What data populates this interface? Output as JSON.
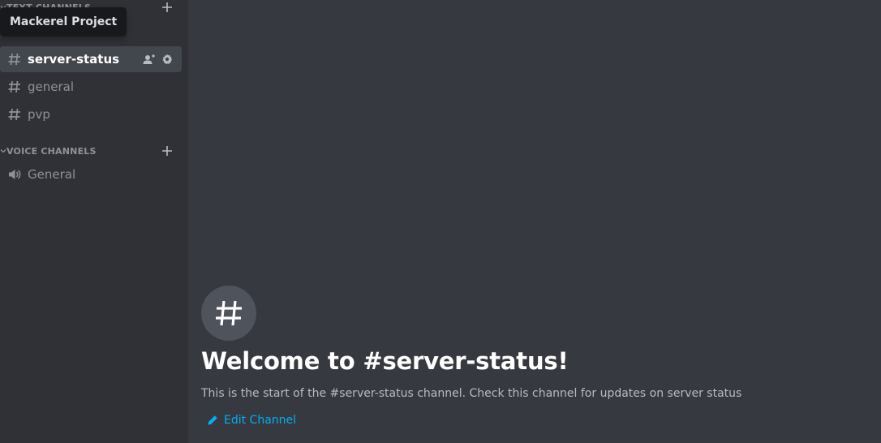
{
  "sidebar": {
    "tooltip": "Mackerel Project",
    "text_category": {
      "label": "TEXT CHANNELS",
      "icon": "chevron-down-icon",
      "add_icon": "plus-icon"
    },
    "text_channels": [
      {
        "name": "server-status",
        "icon": "hash-icon",
        "active": true
      },
      {
        "name": "general",
        "icon": "hash-icon",
        "active": false
      },
      {
        "name": "pvp",
        "icon": "hash-icon",
        "active": false
      }
    ],
    "active_channel_actions": [
      "invite-icon",
      "gear-icon"
    ],
    "voice_category": {
      "label": "VOICE CHANNELS",
      "icon": "chevron-down-icon",
      "add_icon": "plus-icon"
    },
    "voice_channels": [
      {
        "name": "General",
        "icon": "speaker-icon"
      }
    ]
  },
  "main": {
    "welcome_icon": "hash-icon",
    "welcome_title": "Welcome to #server-status!",
    "welcome_description": "This is the start of the #server-status channel. Check this channel for updates on server status",
    "edit_channel_label": "Edit Channel",
    "edit_icon": "pencil-icon"
  },
  "colors": {
    "sidebar_bg": "#2f3136",
    "main_bg": "#36393f",
    "active_channel_bg": "#42464d",
    "tooltip_bg": "#18191c",
    "link": "#00aff4",
    "muted_text": "#8e9297",
    "description_text": "#b9bbbe"
  }
}
